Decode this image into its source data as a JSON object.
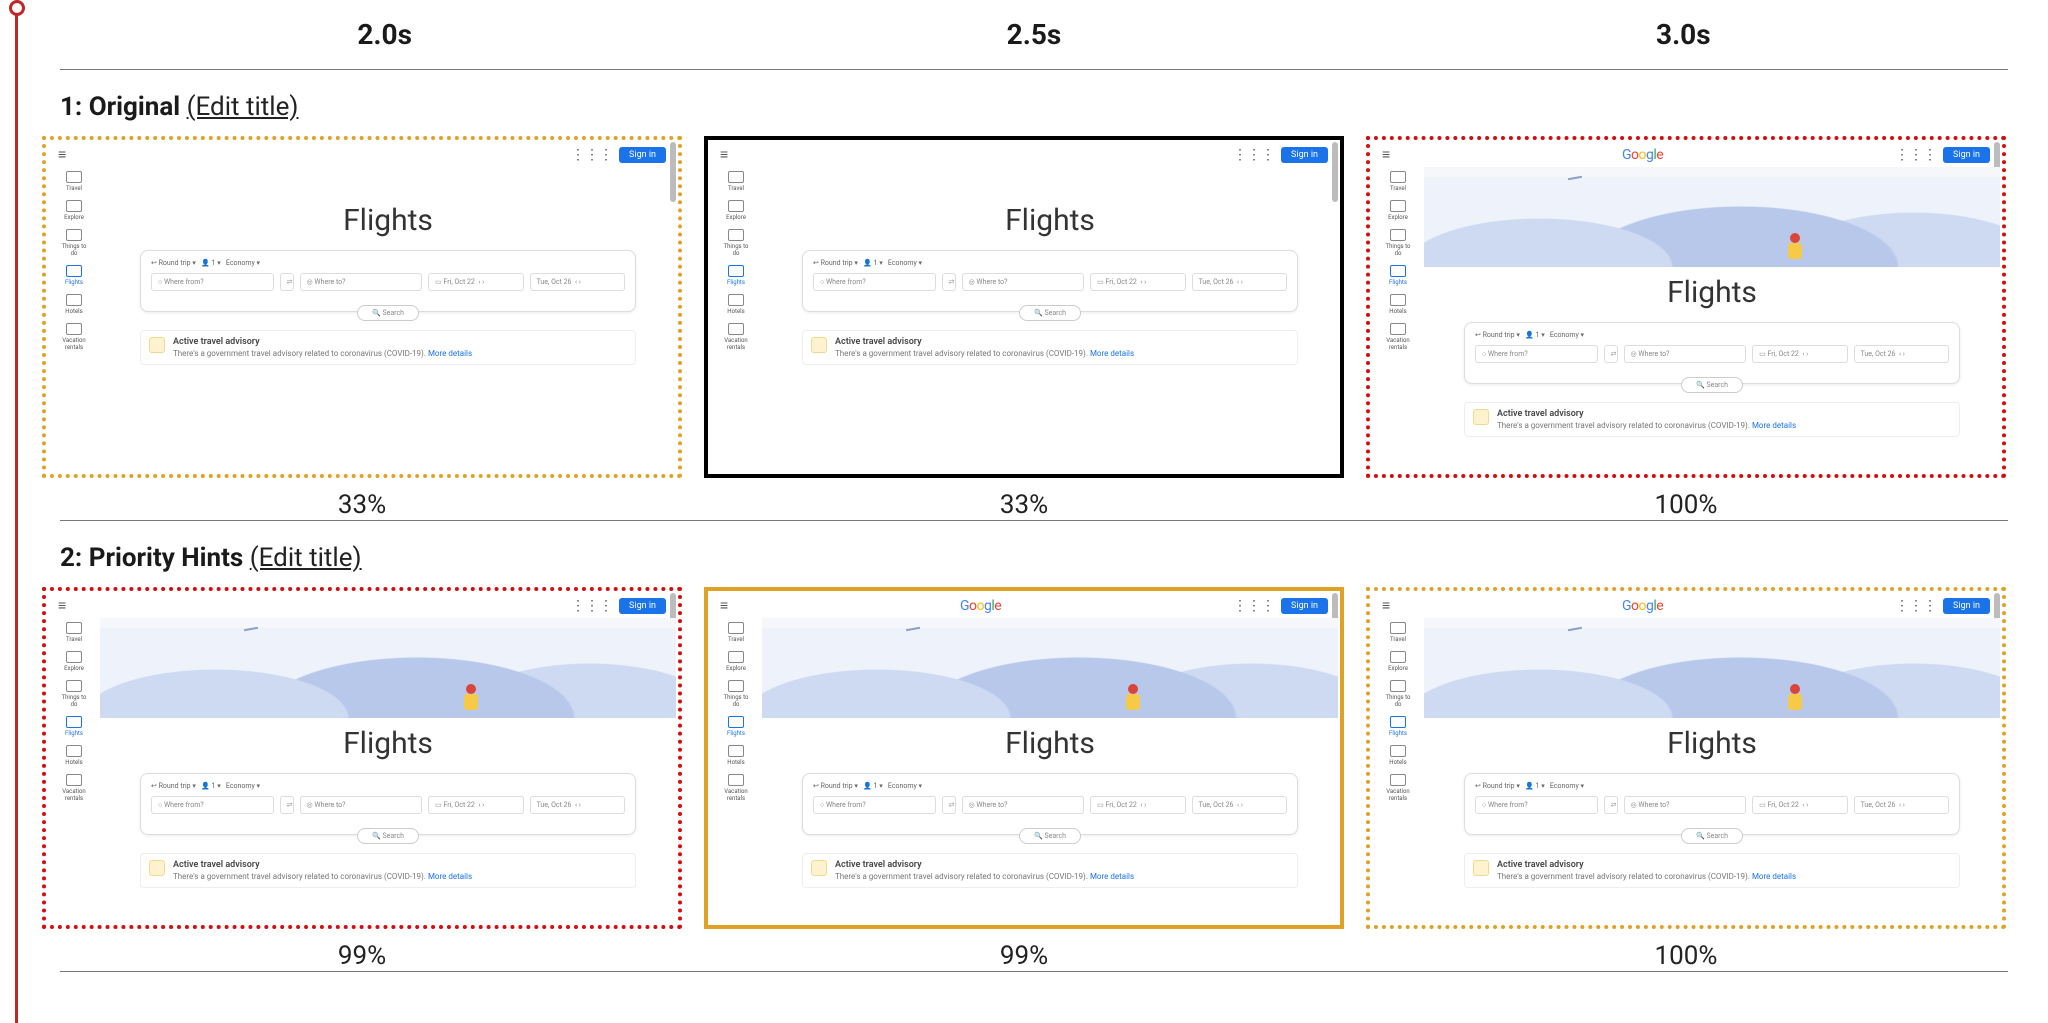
{
  "timeline": {
    "times": [
      "2.0s",
      "2.5s",
      "3.0s"
    ]
  },
  "edit_title_label": "(Edit title)",
  "rows": [
    {
      "index": "1",
      "title": "Original",
      "slots": [
        {
          "pct": "33%",
          "hero": false,
          "logo": false,
          "outer_frame": "dotted-orange",
          "left_marker": true
        },
        {
          "pct": "33%",
          "hero": false,
          "logo": false,
          "outer_frame": "solid-black",
          "left_marker": false
        },
        {
          "pct": "100%",
          "hero": true,
          "logo": true,
          "outer_frame": "dotted-red",
          "left_marker": false
        }
      ]
    },
    {
      "index": "2",
      "title": "Priority Hints",
      "slots": [
        {
          "pct": "99%",
          "hero": true,
          "logo": false,
          "outer_frame": "dotted-red",
          "left_marker": true
        },
        {
          "pct": "99%",
          "hero": true,
          "logo": true,
          "outer_frame": "solid-orange",
          "left_marker": false
        },
        {
          "pct": "100%",
          "hero": true,
          "logo": true,
          "outer_frame": "dotted-orange",
          "left_marker": false
        }
      ]
    }
  ],
  "gf": {
    "logo_text": "Google",
    "signin": "Sign in",
    "page_title": "Flights",
    "sidebar": [
      "Travel",
      "Explore",
      "Things to do",
      "Flights",
      "Hotels",
      "Vacation rentals"
    ],
    "sidebar_active": "Flights",
    "opts": {
      "trip": "Round trip",
      "pax": "1",
      "class": "Economy"
    },
    "fields": {
      "from": "Where from?",
      "to": "Where to?",
      "date1": "Fri, Oct 22",
      "date2": "Tue, Oct 26"
    },
    "search_btn": "Search",
    "advisory": {
      "title": "Active travel advisory",
      "body": "There's a government travel advisory related to coronavirus (COVID-19).",
      "link": "More details"
    }
  }
}
